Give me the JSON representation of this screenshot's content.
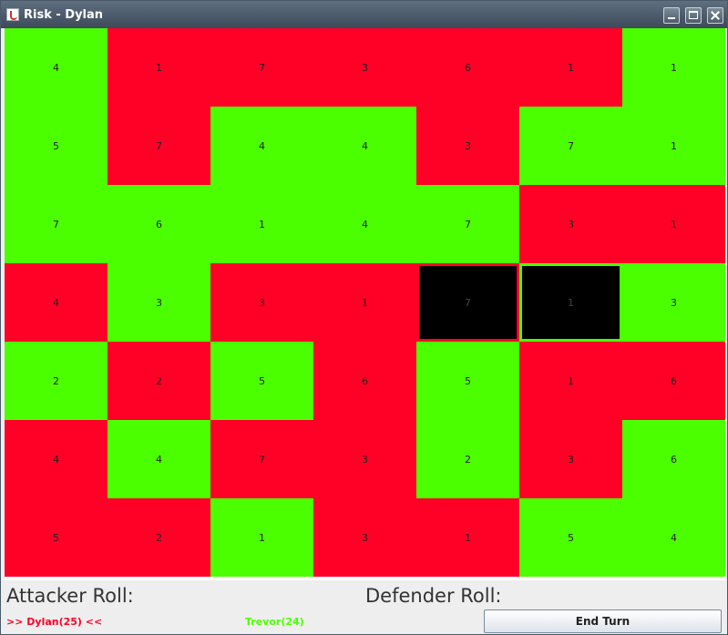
{
  "window": {
    "title": "Risk - Dylan",
    "icon": "java-cup-icon"
  },
  "board": {
    "rows": [
      [
        {
          "v": "4",
          "c": "green"
        },
        {
          "v": "1",
          "c": "red"
        },
        {
          "v": "7",
          "c": "red"
        },
        {
          "v": "3",
          "c": "red"
        },
        {
          "v": "6",
          "c": "red"
        },
        {
          "v": "1",
          "c": "red"
        },
        {
          "v": "1",
          "c": "green"
        }
      ],
      [
        {
          "v": "5",
          "c": "green"
        },
        {
          "v": "7",
          "c": "red"
        },
        {
          "v": "4",
          "c": "green"
        },
        {
          "v": "4",
          "c": "green"
        },
        {
          "v": "3",
          "c": "red"
        },
        {
          "v": "7",
          "c": "green"
        },
        {
          "v": "1",
          "c": "green"
        }
      ],
      [
        {
          "v": "7",
          "c": "green"
        },
        {
          "v": "6",
          "c": "green"
        },
        {
          "v": "1",
          "c": "green"
        },
        {
          "v": "4",
          "c": "green"
        },
        {
          "v": "7",
          "c": "green"
        },
        {
          "v": "3",
          "c": "red"
        },
        {
          "v": "1",
          "c": "red"
        }
      ],
      [
        {
          "v": "4",
          "c": "red"
        },
        {
          "v": "3",
          "c": "green"
        },
        {
          "v": "3",
          "c": "red"
        },
        {
          "v": "1",
          "c": "red"
        },
        {
          "v": "7",
          "c": "red",
          "sel": true
        },
        {
          "v": "1",
          "c": "green",
          "sel": true
        },
        {
          "v": "3",
          "c": "green"
        }
      ],
      [
        {
          "v": "2",
          "c": "green"
        },
        {
          "v": "2",
          "c": "red"
        },
        {
          "v": "5",
          "c": "green"
        },
        {
          "v": "6",
          "c": "red"
        },
        {
          "v": "5",
          "c": "green"
        },
        {
          "v": "1",
          "c": "red"
        },
        {
          "v": "6",
          "c": "red"
        }
      ],
      [
        {
          "v": "4",
          "c": "red"
        },
        {
          "v": "4",
          "c": "green"
        },
        {
          "v": "7",
          "c": "red"
        },
        {
          "v": "3",
          "c": "red"
        },
        {
          "v": "2",
          "c": "green"
        },
        {
          "v": "3",
          "c": "red"
        },
        {
          "v": "6",
          "c": "green"
        }
      ],
      [
        {
          "v": "5",
          "c": "red"
        },
        {
          "v": "2",
          "c": "red"
        },
        {
          "v": "1",
          "c": "green"
        },
        {
          "v": "3",
          "c": "red"
        },
        {
          "v": "1",
          "c": "red"
        },
        {
          "v": "5",
          "c": "green"
        },
        {
          "v": "4",
          "c": "green"
        }
      ]
    ]
  },
  "status": {
    "attacker_label": "Attacker Roll:",
    "defender_label": "Defender Roll:",
    "player1": ">> Dylan(25) <<",
    "player2": "Trevor(24)",
    "end_turn": "End Turn"
  },
  "colors": {
    "red_player": "#ff0027",
    "green_player": "#4cff00",
    "selected": "#000000"
  }
}
